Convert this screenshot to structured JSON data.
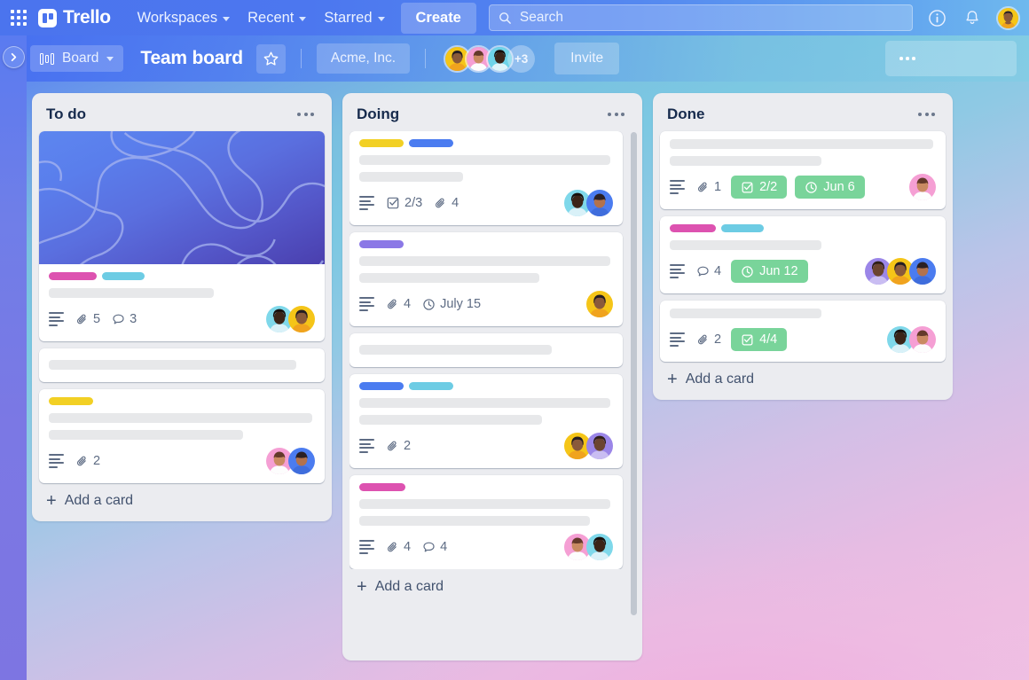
{
  "topnav": {
    "apps_icon": "app-grid-icon",
    "brand": "Trello",
    "items": [
      {
        "label": "Workspaces",
        "icon": "chevron-down-icon"
      },
      {
        "label": "Recent",
        "icon": "chevron-down-icon"
      },
      {
        "label": "Starred",
        "icon": "chevron-down-icon"
      }
    ],
    "create_label": "Create",
    "search": {
      "placeholder": "Search",
      "icon": "search-icon"
    },
    "info_icon": "info-circle-icon",
    "notifications_icon": "bell-icon",
    "account_icon": "user-avatar"
  },
  "boardbar": {
    "sidebar_toggle_icon": "chevron-right-icon",
    "view_icon": "board-view-icon",
    "view_label": "Board",
    "view_chevron": "chevron-down-icon",
    "title": "Team board",
    "star_icon": "star-outline-icon",
    "workspace": "Acme, Inc.",
    "members_overflow": "+3",
    "invite_label": "Invite",
    "menu_icon": "more-horizontal-icon"
  },
  "colors": {
    "label_magenta": "#dd52b0",
    "label_sky": "#6dcce4",
    "label_yellow": "#f2d024",
    "label_blue": "#4b7cf0",
    "label_purple": "#8b78e6",
    "badge_green": "#79d49a",
    "card_white": "#ffffff",
    "list_grey": "#ebecf0",
    "text_dark": "#172b4d",
    "text_muted": "#5e6c84",
    "nav_blue": "#4b74ee"
  },
  "lists": [
    {
      "title": "To do",
      "menu_icon": "more-horizontal-icon",
      "add_card_label": "Add a card",
      "cards": [
        {
          "name": "card-cover-labels",
          "cover": true,
          "labels": [
            "label_magenta",
            "label_sky"
          ],
          "ghost_lines": [
            62
          ],
          "meta": [
            {
              "type": "description",
              "icon": "description-icon"
            },
            {
              "type": "attachment",
              "icon": "paperclip-icon",
              "value": "5"
            },
            {
              "type": "comment",
              "icon": "comment-icon",
              "value": "3"
            }
          ],
          "avatars": [
            "avatar-teal-woman",
            "avatar-yellow-woman"
          ]
        },
        {
          "name": "card-plain",
          "cover": false,
          "labels": [],
          "ghost_lines": [
            93
          ],
          "meta": [],
          "avatars": []
        },
        {
          "name": "card-yellow-label",
          "cover": false,
          "labels": [
            "label_yellow"
          ],
          "ghost_lines": [
            99,
            73
          ],
          "meta": [
            {
              "type": "description",
              "icon": "description-icon"
            },
            {
              "type": "attachment",
              "icon": "paperclip-icon",
              "value": "2"
            }
          ],
          "avatars": [
            "avatar-pink-man",
            "avatar-blue-man"
          ]
        }
      ]
    },
    {
      "title": "Doing",
      "menu_icon": "more-horizontal-icon",
      "add_card_label": "Add a card",
      "scrollbar": true,
      "cards": [
        {
          "name": "card-checklist",
          "cover": false,
          "labels": [
            "label_yellow",
            "label_blue"
          ],
          "ghost_lines": [
            99,
            41
          ],
          "meta": [
            {
              "type": "description",
              "icon": "description-icon"
            },
            {
              "type": "checklist",
              "icon": "checklist-icon",
              "value": "2/3"
            },
            {
              "type": "attachment",
              "icon": "paperclip-icon",
              "value": "4"
            }
          ],
          "avatars": [
            "avatar-teal-woman",
            "avatar-blue-man"
          ]
        },
        {
          "name": "card-due-july",
          "cover": false,
          "labels": [
            "label_purple"
          ],
          "ghost_lines": [
            99,
            71
          ],
          "meta": [
            {
              "type": "description",
              "icon": "description-icon"
            },
            {
              "type": "attachment",
              "icon": "paperclip-icon",
              "value": "4"
            },
            {
              "type": "due",
              "icon": "clock-icon",
              "value": "July 15"
            }
          ],
          "avatars": [
            "avatar-yellow-woman"
          ]
        },
        {
          "name": "card-plain",
          "cover": false,
          "labels": [],
          "ghost_lines": [
            76
          ],
          "meta": [],
          "avatars": []
        },
        {
          "name": "card-blue-sky-labels",
          "cover": false,
          "labels": [
            "label_blue",
            "label_sky"
          ],
          "ghost_lines": [
            99,
            72
          ],
          "meta": [
            {
              "type": "description",
              "icon": "description-icon"
            },
            {
              "type": "attachment",
              "icon": "paperclip-icon",
              "value": "2"
            }
          ],
          "avatars": [
            "avatar-yellow-woman",
            "avatar-purple-man"
          ]
        },
        {
          "name": "card-magenta-label",
          "cover": false,
          "labels": [
            "label_magenta"
          ],
          "ghost_lines": [
            99,
            91
          ],
          "meta": [
            {
              "type": "description",
              "icon": "description-icon"
            },
            {
              "type": "attachment",
              "icon": "paperclip-icon",
              "value": "4"
            },
            {
              "type": "comment",
              "icon": "comment-icon",
              "value": "4"
            }
          ],
          "avatars": [
            "avatar-pink-man",
            "avatar-teal-woman"
          ]
        }
      ]
    },
    {
      "title": "Done",
      "menu_icon": "more-horizontal-icon",
      "add_card_label": "Add a card",
      "cards": [
        {
          "name": "card-done-jun6",
          "cover": false,
          "labels": [],
          "ghost_lines": [
            99,
            57
          ],
          "meta": [
            {
              "type": "description",
              "icon": "description-icon"
            },
            {
              "type": "attachment",
              "icon": "paperclip-icon",
              "value": "1"
            },
            {
              "type": "checklist-badge",
              "icon": "checklist-icon",
              "value": "2/2"
            },
            {
              "type": "due-badge",
              "icon": "clock-icon",
              "value": "Jun 6"
            }
          ],
          "avatars": [
            "avatar-pink-man"
          ]
        },
        {
          "name": "card-done-jun12",
          "cover": false,
          "labels": [
            "label_magenta",
            "label_sky"
          ],
          "ghost_lines": [
            57
          ],
          "meta": [
            {
              "type": "description",
              "icon": "description-icon"
            },
            {
              "type": "comment",
              "icon": "comment-icon",
              "value": "4"
            },
            {
              "type": "due-badge",
              "icon": "clock-icon",
              "value": "Jun 12"
            }
          ],
          "avatars": [
            "avatar-purple-man",
            "avatar-yellow-woman",
            "avatar-blue-man"
          ]
        },
        {
          "name": "card-done-4of4",
          "cover": false,
          "labels": [],
          "ghost_lines": [
            57
          ],
          "meta": [
            {
              "type": "description",
              "icon": "description-icon"
            },
            {
              "type": "attachment",
              "icon": "paperclip-icon",
              "value": "2"
            },
            {
              "type": "checklist-badge",
              "icon": "checklist-icon",
              "value": "4/4"
            }
          ],
          "avatars": [
            "avatar-teal-woman",
            "avatar-pink-man"
          ]
        }
      ]
    }
  ]
}
